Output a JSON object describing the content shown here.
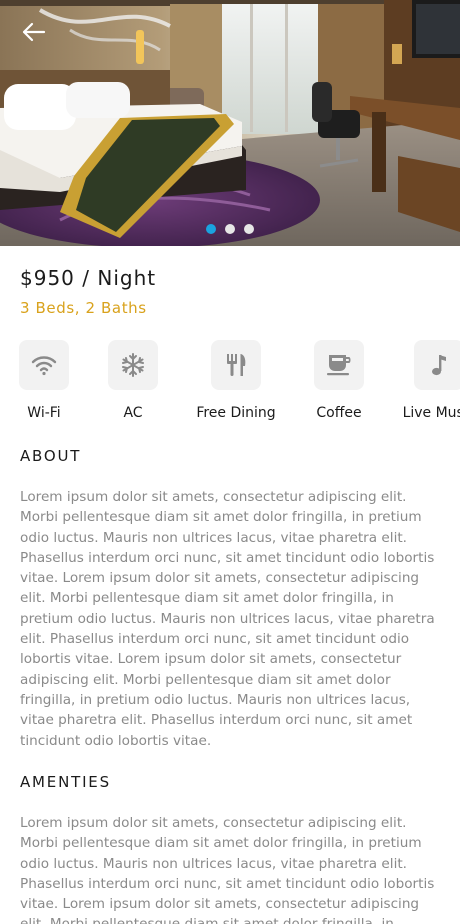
{
  "hero": {
    "image": "hotel-room-photo",
    "back_icon": "back-arrow-icon",
    "slides_total": 3,
    "slide_active": 1
  },
  "listing": {
    "price": "$950 / Night",
    "rooms": "3 Beds, 2 Baths"
  },
  "amenities": [
    {
      "icon": "wifi-icon",
      "label": "Wi-Fi"
    },
    {
      "icon": "snowflake-icon",
      "label": "AC"
    },
    {
      "icon": "fork-knife-icon",
      "label": "Free Dining"
    },
    {
      "icon": "coffee-cup-icon",
      "label": "Coffee"
    },
    {
      "icon": "music-note-icon",
      "label": "Live Music"
    }
  ],
  "about": {
    "title": "ABOUT",
    "body": "Lorem ipsum dolor sit amets, consectetur adipiscing elit. Morbi pellentesque diam sit amet dolor fringilla, in pretium odio luctus. Mauris non ultrices lacus, vitae pharetra elit. Phasellus interdum orci nunc, sit amet tincidunt odio lobortis vitae. Lorem ipsum dolor sit amets, consectetur adipiscing elit. Morbi pellentesque diam sit amet dolor fringilla, in pretium odio luctus. Mauris non ultrices lacus, vitae pharetra elit. Phasellus interdum orci nunc, sit amet tincidunt odio lobortis vitae. Lorem ipsum dolor sit amets, consectetur adipiscing elit. Morbi pellentesque diam sit amet dolor fringilla, in pretium odio luctus. Mauris non ultrices lacus, vitae pharetra elit. Phasellus interdum orci nunc, sit amet tincidunt odio lobortis vitae."
  },
  "amenties": {
    "title": "AMENTIES",
    "body": "Lorem ipsum dolor sit amets, consectetur adipiscing elit. Morbi pellentesque diam sit amet dolor fringilla, in pretium odio luctus. Mauris non ultrices lacus, vitae pharetra elit. Phasellus interdum orci nunc, sit amet tincidunt odio lobortis vitae. Lorem ipsum dolor sit amets, consectetur adipiscing elit. Morbi pellentesque diam sit amet dolor fringilla, in pretium odio luctus."
  },
  "colors": {
    "accent": "#d9a21c",
    "dot_active": "#1aa3e0",
    "dot_inactive": "#e6e6e6",
    "icon_bg": "#f2f2f2",
    "body_text": "#8a8a8a"
  }
}
